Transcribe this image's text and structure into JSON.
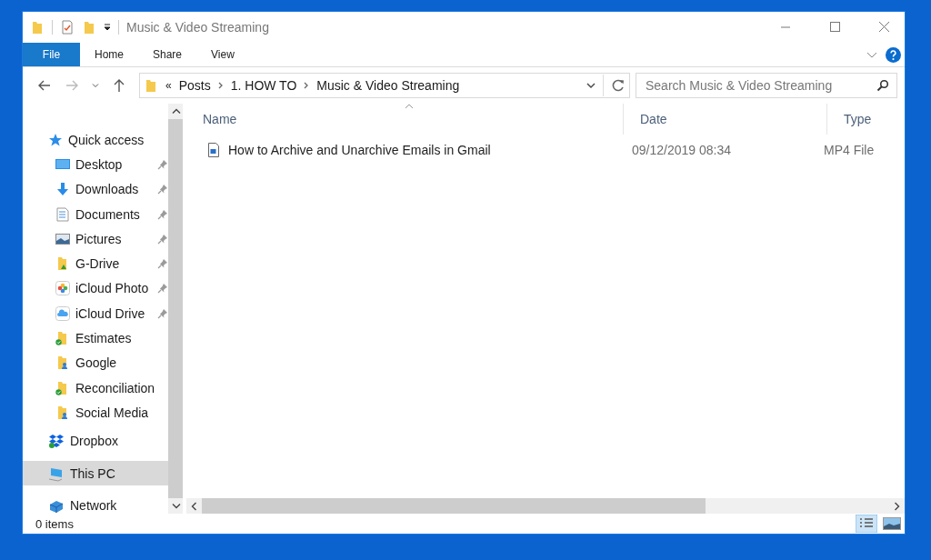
{
  "window": {
    "title": "Music & Video Streaming"
  },
  "ribbon_tabs": [
    {
      "label": "File",
      "selected": true
    },
    {
      "label": "Home",
      "selected": false
    },
    {
      "label": "Share",
      "selected": false
    },
    {
      "label": "View",
      "selected": false
    }
  ],
  "address": {
    "overflow": "«",
    "crumbs": [
      "Posts",
      "1. HOW TO",
      "Music & Video Streaming"
    ]
  },
  "search": {
    "placeholder": "Search Music & Video Streaming"
  },
  "sidebar": {
    "items": [
      {
        "label": "Quick access",
        "kind": "star",
        "selected": false,
        "children": [
          {
            "label": "Desktop",
            "kind": "desktop",
            "pinned": true
          },
          {
            "label": "Downloads",
            "kind": "download",
            "pinned": true
          },
          {
            "label": "Documents",
            "kind": "document",
            "pinned": true
          },
          {
            "label": "Pictures",
            "kind": "pictures",
            "pinned": true
          },
          {
            "label": "G-Drive",
            "kind": "gdrive",
            "pinned": true
          },
          {
            "label": "iCloud Photo",
            "kind": "photos",
            "pinned": true
          },
          {
            "label": "iCloud Drive",
            "kind": "cloud",
            "pinned": true
          },
          {
            "label": "Estimates",
            "kind": "folder-synced",
            "pinned": false
          },
          {
            "label": "Google",
            "kind": "folder-user",
            "pinned": false
          },
          {
            "label": "Reconciliation",
            "kind": "folder-synced",
            "pinned": false
          },
          {
            "label": "Social Media",
            "kind": "folder-user",
            "pinned": false
          }
        ]
      },
      {
        "label": "Dropbox",
        "kind": "dropbox",
        "selected": false
      },
      {
        "label": "This PC",
        "kind": "pc",
        "selected": true
      },
      {
        "label": "Network",
        "kind": "network",
        "selected": false
      }
    ]
  },
  "table": {
    "columns": [
      "Name",
      "Date",
      "Type"
    ],
    "rows": [
      {
        "name": "How to Archive and Unarchive Emails in Gmail",
        "date": "09/12/2019 08:34",
        "type": "MP4 File"
      }
    ]
  },
  "status_bar": {
    "text": "0 items"
  }
}
